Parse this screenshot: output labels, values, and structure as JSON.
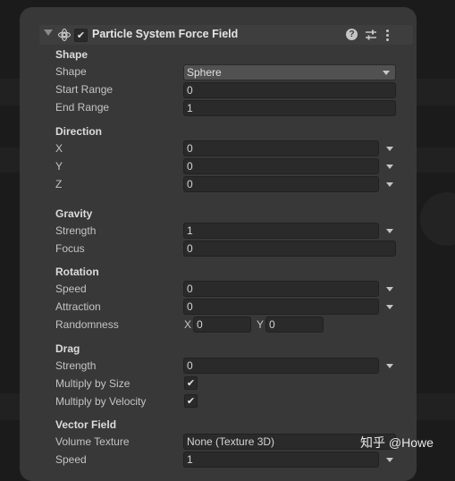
{
  "component": {
    "title": "Particle System Force Field",
    "enabled_mark": "✔",
    "help": "?",
    "icons": [
      "foldout-arrow",
      "force-field-icon",
      "help-icon",
      "preset-icon",
      "context-menu-icon"
    ]
  },
  "shape": {
    "header": "Shape",
    "shape_label": "Shape",
    "shape_value": "Sphere",
    "start_range_label": "Start Range",
    "start_range": "0",
    "end_range_label": "End Range",
    "end_range": "1"
  },
  "direction": {
    "header": "Direction",
    "x_label": "X",
    "x": "0",
    "y_label": "Y",
    "y": "0",
    "z_label": "Z",
    "z": "0"
  },
  "gravity": {
    "header": "Gravity",
    "strength_label": "Strength",
    "strength": "1",
    "focus_label": "Focus",
    "focus": "0"
  },
  "rotation": {
    "header": "Rotation",
    "speed_label": "Speed",
    "speed": "0",
    "attraction_label": "Attraction",
    "attraction": "0",
    "randomness_label": "Randomness",
    "rand_x_label": "X",
    "rand_x": "0",
    "rand_y_label": "Y",
    "rand_y": "0"
  },
  "drag": {
    "header": "Drag",
    "strength_label": "Strength",
    "strength": "0",
    "multiply_size_label": "Multiply by Size",
    "multiply_size_mark": "✔",
    "multiply_velocity_label": "Multiply by Velocity",
    "multiply_velocity_mark": "✔"
  },
  "vector_field": {
    "header": "Vector Field",
    "volume_texture_label": "Volume Texture",
    "volume_texture": "None (Texture 3D)",
    "speed_label": "Speed",
    "speed": "1"
  },
  "watermark": "知乎 @Howe",
  "colors": {
    "background": "#1b1b1b",
    "panel": "#383838",
    "field": "#2a2a2a",
    "dropdown": "#515151",
    "text": "#c4c4c4"
  }
}
